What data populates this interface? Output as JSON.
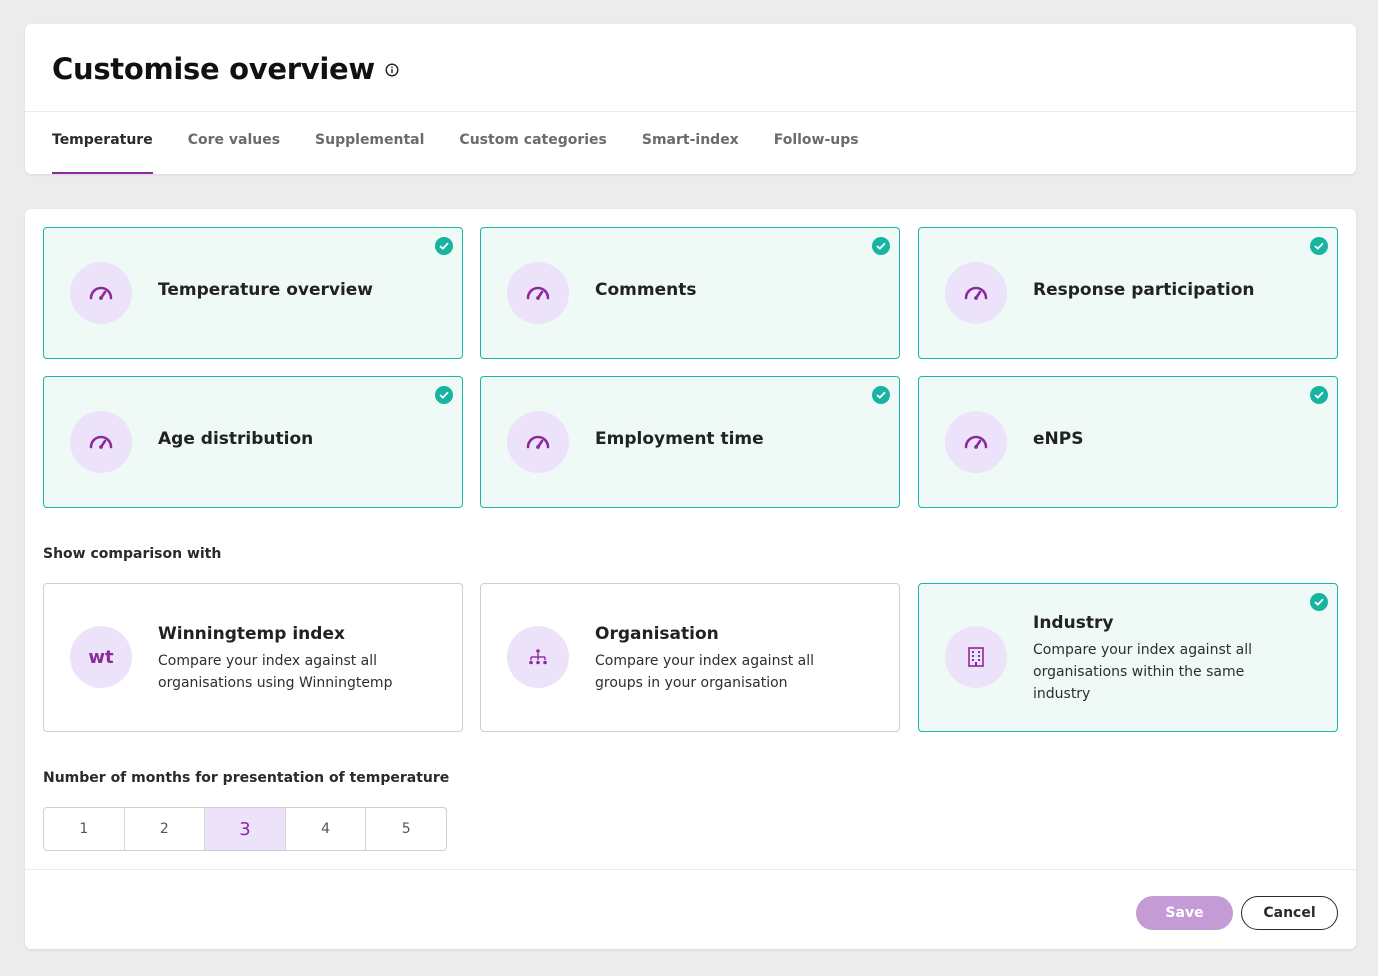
{
  "header": {
    "title": "Customise overview",
    "tabs": [
      {
        "label": "Temperature",
        "active": true
      },
      {
        "label": "Core values",
        "active": false
      },
      {
        "label": "Supplemental",
        "active": false
      },
      {
        "label": "Custom categories",
        "active": false
      },
      {
        "label": "Smart-index",
        "active": false
      },
      {
        "label": "Follow-ups",
        "active": false
      }
    ]
  },
  "widgets": [
    {
      "label": "Temperature overview",
      "selected": true,
      "icon": "gauge-icon"
    },
    {
      "label": "Comments",
      "selected": true,
      "icon": "gauge-icon"
    },
    {
      "label": "Response participation",
      "selected": true,
      "icon": "gauge-icon"
    },
    {
      "label": "Age distribution",
      "selected": true,
      "icon": "gauge-icon"
    },
    {
      "label": "Employment time",
      "selected": true,
      "icon": "gauge-icon"
    },
    {
      "label": "eNPS",
      "selected": true,
      "icon": "gauge-icon"
    }
  ],
  "comparison": {
    "label": "Show comparison with",
    "options": [
      {
        "title": "Winningtemp index",
        "description": "Compare your index against all organisations using Winningtemp",
        "icon_text": "wt",
        "selected": false
      },
      {
        "title": "Organisation",
        "description": "Compare your index against all groups in your organisation",
        "icon": "org-tree-icon",
        "selected": false
      },
      {
        "title": "Industry",
        "description": "Compare your index against all organisations within the same industry",
        "icon": "building-icon",
        "selected": true
      }
    ]
  },
  "months": {
    "label": "Number of months for presentation of temperature",
    "options": [
      "1",
      "2",
      "3",
      "4",
      "5"
    ],
    "selected": "3"
  },
  "actions": {
    "save_label": "Save",
    "cancel_label": "Cancel"
  },
  "colors": {
    "accent": "#8a2a9b",
    "selected_border": "#1bb5a6",
    "selected_bg": "#effaf7",
    "icon_bg": "#ece3fb",
    "check": "#17b4a2"
  }
}
